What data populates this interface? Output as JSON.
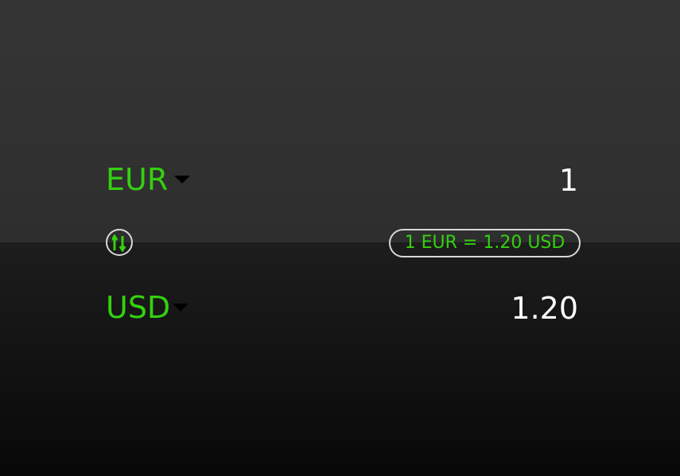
{
  "converter": {
    "from": {
      "currency": "EUR",
      "amount": "1"
    },
    "to": {
      "currency": "USD",
      "amount": "1.20"
    },
    "rate_text": "1 EUR = 1.20 USD",
    "swap_icon": "swap-vertical-arrows-icon",
    "dropdown_icon": "caret-down-icon"
  },
  "colors": {
    "accent": "#34d10f",
    "amount_text": "#ffffff",
    "top_background": "#333333",
    "bottom_background": "#121212",
    "outline": "#d8d8d8"
  }
}
